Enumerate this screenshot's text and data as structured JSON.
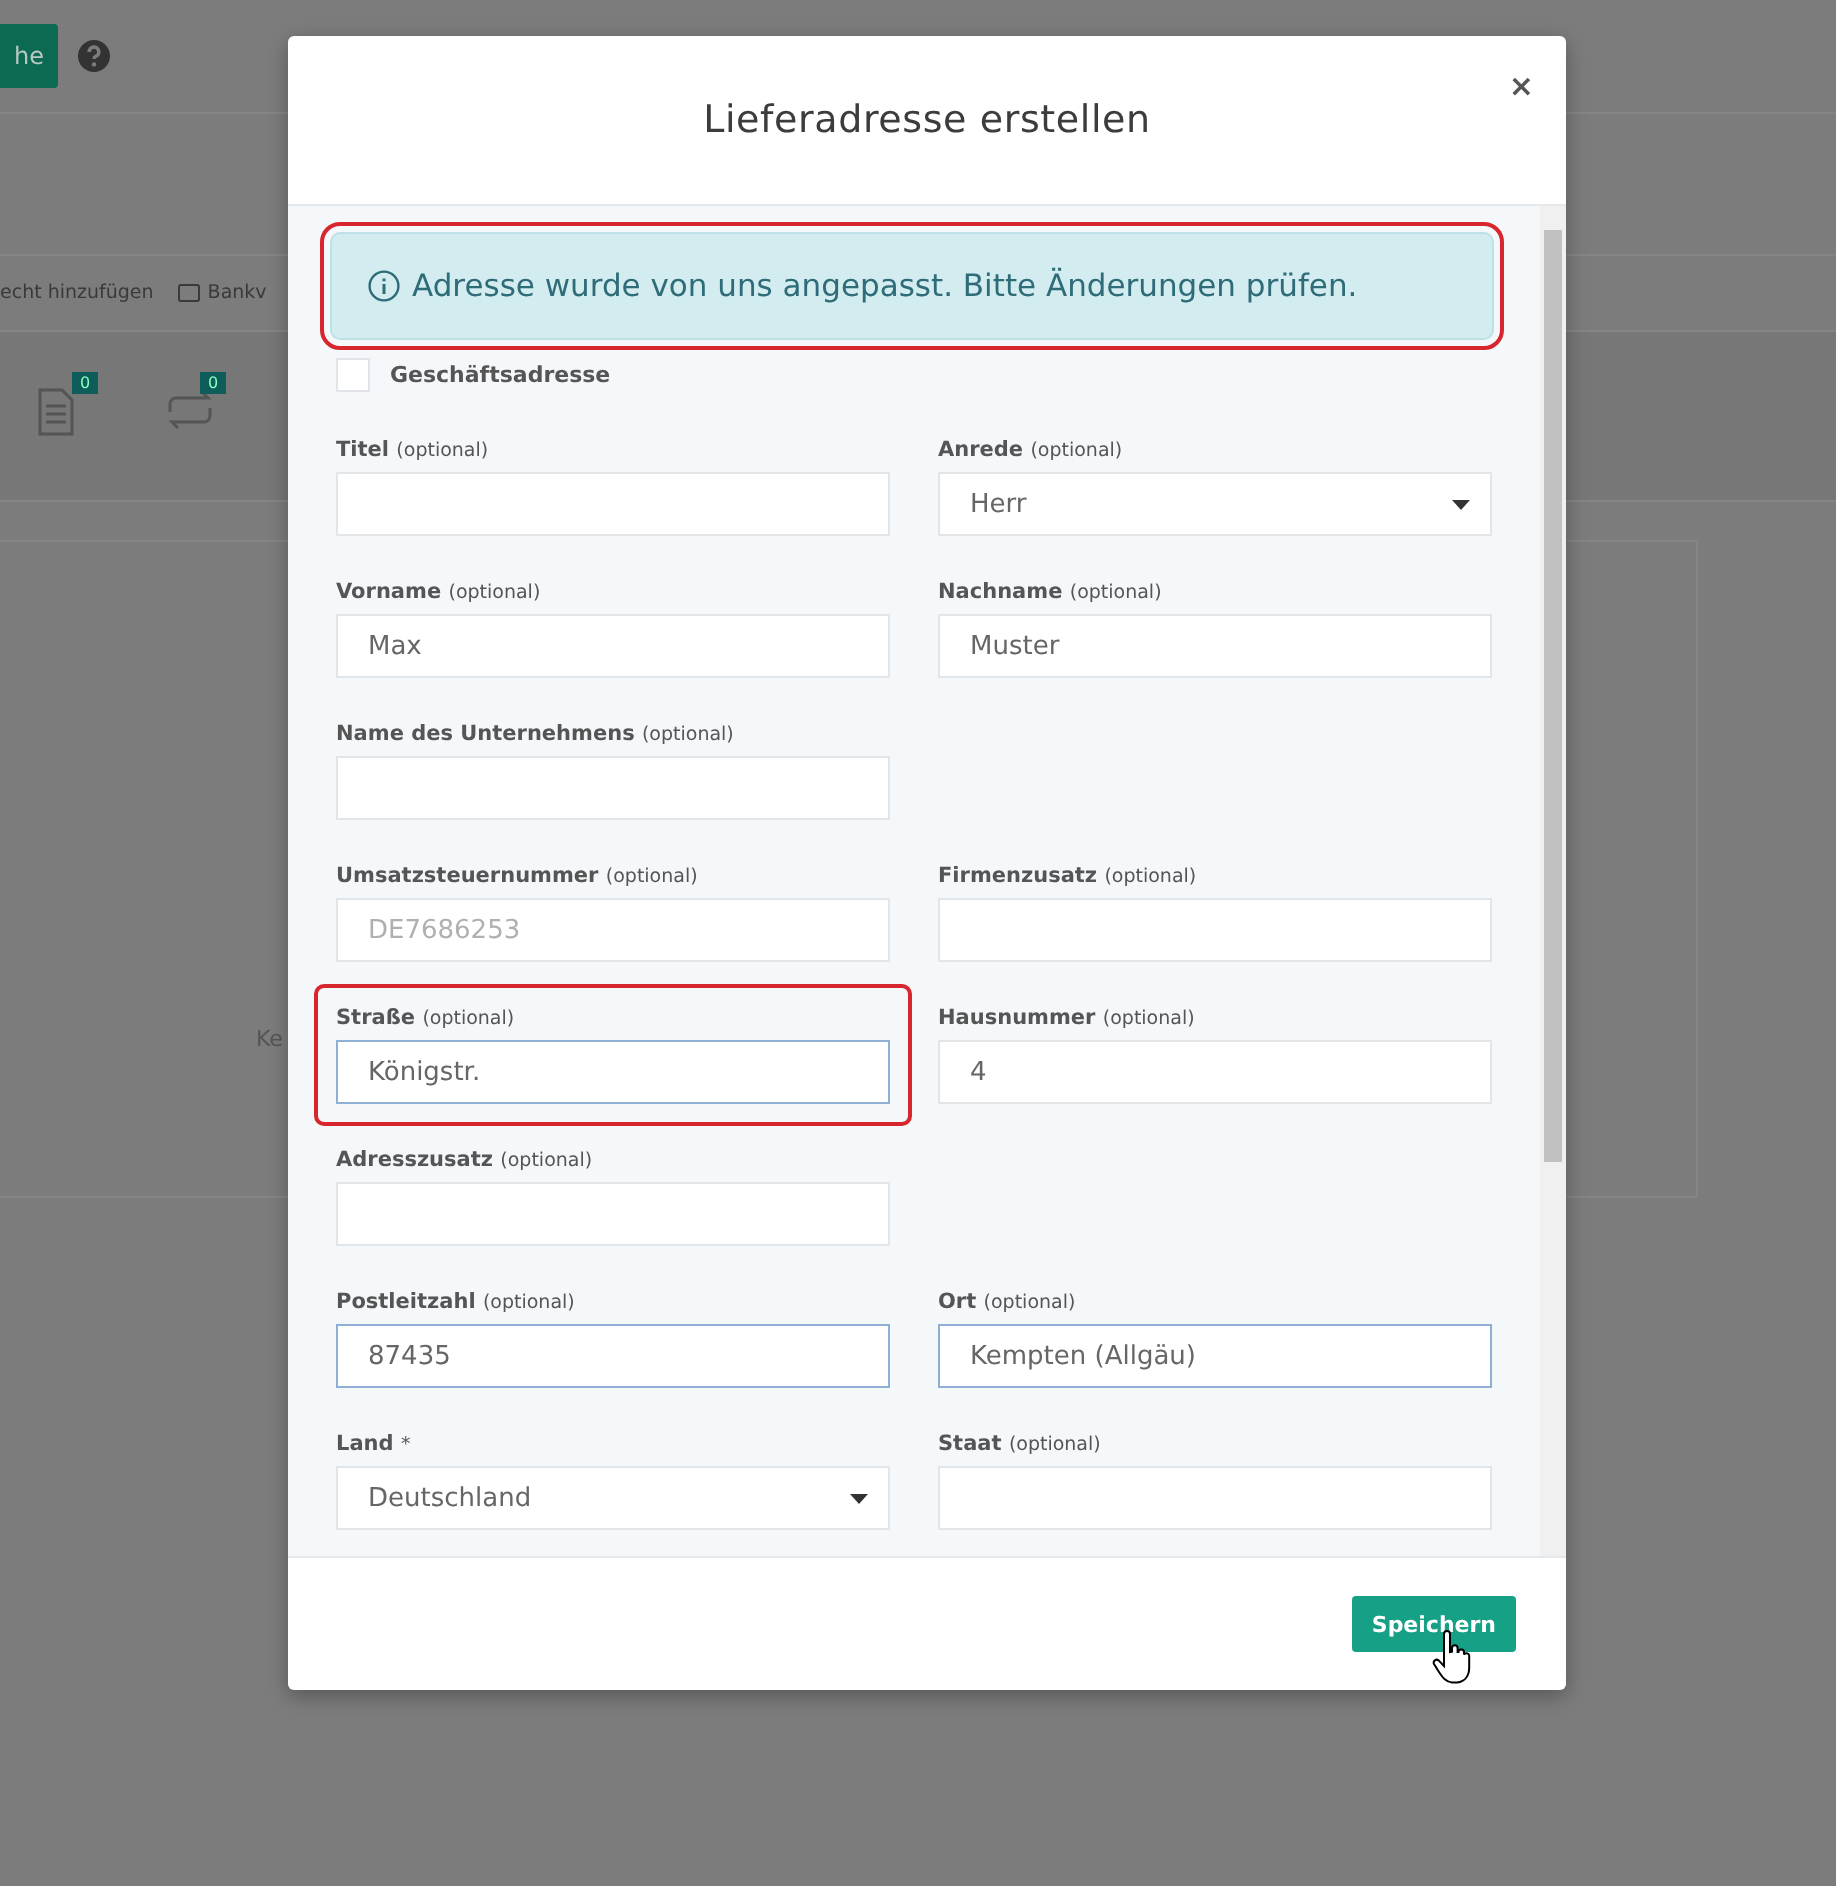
{
  "background": {
    "button_label": "he",
    "toolbar": [
      "echt hinzufügen",
      "Bankv"
    ],
    "badges": [
      "0",
      "0"
    ],
    "panel_text": "Ke"
  },
  "modal": {
    "title": "Lieferadresse erstellen",
    "close": "×",
    "alert": {
      "text": "Adresse wurde von uns angepasst. Bitte Änderungen prüfen.",
      "highlighted": true
    },
    "checkbox": {
      "label": "Geschäftsadresse",
      "checked": false
    },
    "rows": [
      [
        {
          "kind": "text",
          "label": "Titel",
          "hint": "(optional)",
          "highlighted": false,
          "focused": false
        },
        {
          "kind": "select",
          "label": "Anrede",
          "hint": "(optional)",
          "value": "Herr",
          "highlighted": false,
          "focused": false
        }
      ],
      [
        {
          "kind": "text",
          "label": "Vorname",
          "hint": "(optional)",
          "value": "Max",
          "highlighted": false,
          "focused": false
        },
        {
          "kind": "text",
          "label": "Nachname",
          "hint": "(optional)",
          "value": "Muster",
          "highlighted": false,
          "focused": false
        }
      ],
      [
        {
          "kind": "text",
          "label": "Name des Unternehmens",
          "hint": "(optional)",
          "highlighted": false,
          "focused": false
        }
      ],
      [
        {
          "kind": "text",
          "label": "Umsatzsteuernummer",
          "hint": "(optional)",
          "placeholder": "DE7686253",
          "highlighted": false,
          "focused": false
        },
        {
          "kind": "text",
          "label": "Firmenzusatz",
          "hint": "(optional)",
          "highlighted": false,
          "focused": false
        }
      ],
      [
        {
          "kind": "text",
          "label": "Straße",
          "hint": "(optional)",
          "value": "Königstr.",
          "highlighted": true,
          "focused": true
        },
        {
          "kind": "text",
          "label": "Hausnummer",
          "hint": "(optional)",
          "value": "4",
          "highlighted": false,
          "focused": false
        }
      ],
      [
        {
          "kind": "text",
          "label": "Adresszusatz",
          "hint": "(optional)",
          "highlighted": false,
          "focused": false
        }
      ],
      [
        {
          "kind": "text",
          "label": "Postleitzahl",
          "hint": "(optional)",
          "value": "87435",
          "highlighted": false,
          "focused": true
        },
        {
          "kind": "text",
          "label": "Ort",
          "hint": "(optional)",
          "value": "Kempten (Allgäu)",
          "highlighted": false,
          "focused": true
        }
      ],
      [
        {
          "kind": "select",
          "label": "Land",
          "hint": "*",
          "value": "Deutschland",
          "highlighted": false,
          "focused": false
        },
        {
          "kind": "text",
          "label": "Staat",
          "hint": "(optional)",
          "highlighted": false,
          "focused": false
        }
      ]
    ],
    "save_button": "Speichern"
  }
}
